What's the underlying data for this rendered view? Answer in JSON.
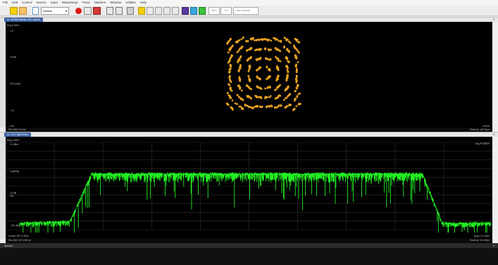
{
  "menu": [
    "File",
    "Edit",
    "Control",
    "Source",
    "Input",
    "MeasSetup",
    "Trace",
    "Markers",
    "Window",
    "Utilities",
    "Help"
  ],
  "toolbar": {
    "preset_label": "Default",
    "color_normal": "Color Normal",
    "value_a": "60.0",
    "value_b": "0.0"
  },
  "constellation_window": {
    "tab_label": "A: OFDM Meas: All Layers",
    "range_label": "Rng 0 dBm",
    "y_ticks": [
      "1.5",
      "Const",
      "200 m/div",
      "-1.5"
    ],
    "bottom_left": "-1.50",
    "bottom_left_sub": "Res BW 10 kHz",
    "bottom_right": "1.5036",
    "bottom_right_sub": "TimeLen 140 Sym",
    "colors": {
      "points": "#e6a020",
      "background": "#000000"
    }
  },
  "spectrum_window": {
    "tab_label": "A: Ch1 Spectrum",
    "range_label": "Rng 0 dBm",
    "top_right": "Avg POWER",
    "y_ticks": [
      "10 dBm",
      "LogMag",
      "10 dB /div",
      "-100 dBm"
    ],
    "bottom_left": "Center 2E7.5 MHz",
    "bottom_left_sub": "Res BW 137.105 Hz",
    "bottom_right": "Span 3.4 MHz",
    "bottom_right_sub": "TimeLen 10 mSec",
    "colors": {
      "trace": "#22ee22",
      "background": "#000000",
      "grid": "#2e2e2e"
    }
  },
  "markers_panel": {
    "title": "Marker"
  }
}
